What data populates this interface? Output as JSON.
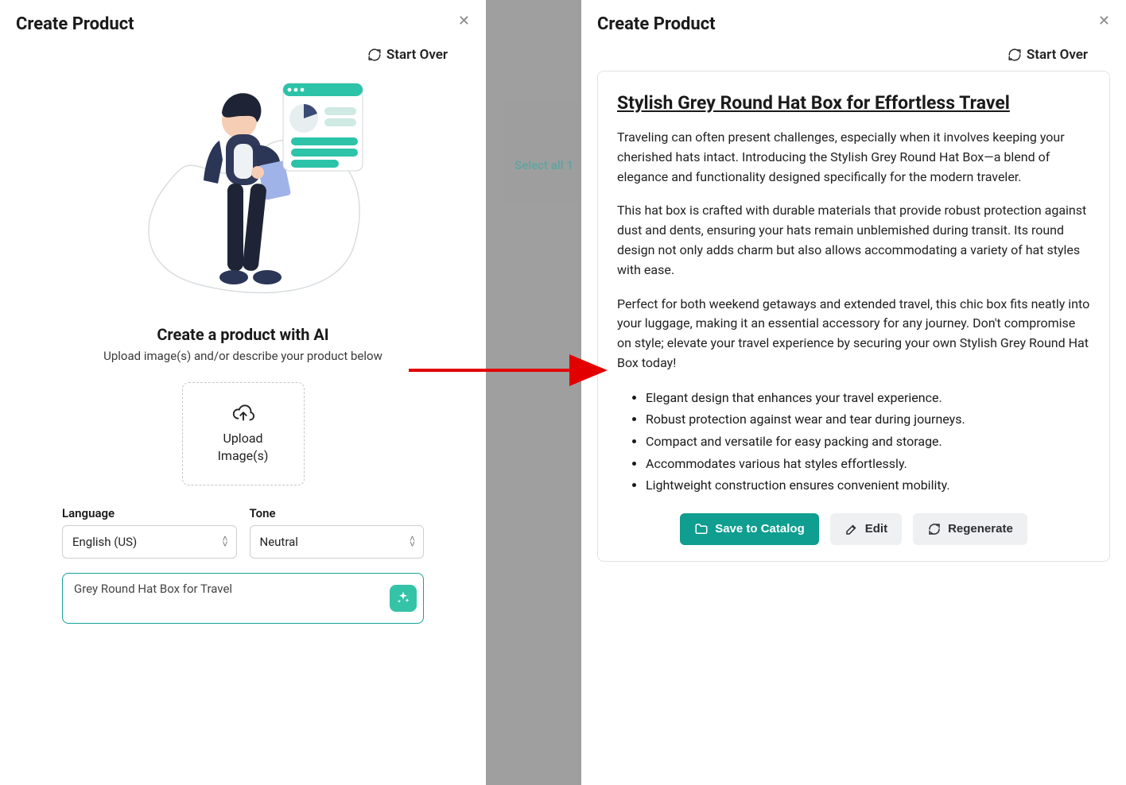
{
  "left": {
    "title": "Create Product",
    "startOver": "Start Over",
    "createHeading": "Create a product with AI",
    "createSub": "Upload image(s) and/or describe your product below",
    "uploadLabel1": "Upload",
    "uploadLabel2": "Image(s)",
    "languageLabel": "Language",
    "languageValue": "English (US)",
    "toneLabel": "Tone",
    "toneValue": "Neutral",
    "promptValue": "Grey Round Hat Box for Travel"
  },
  "mid": {
    "selectAll": "Select all 1"
  },
  "right": {
    "title": "Create Product",
    "startOver": "Start Over",
    "resultTitle": "Stylish Grey Round Hat Box for Effortless Travel",
    "p1": "Traveling can often present challenges, especially when it involves keeping your cherished hats intact. Introducing the Stylish Grey Round Hat Box—a blend of elegance and functionality designed specifically for the modern traveler.",
    "p2": "This hat box is crafted with durable materials that provide robust protection against dust and dents, ensuring your hats remain unblemished during transit. Its round design not only adds charm but also allows accommodating a variety of hat styles with ease.",
    "p3": "Perfect for both weekend getaways and extended travel, this chic box fits neatly into your luggage, making it an essential accessory for any journey. Don't compromise on style; elevate your travel experience by securing your own Stylish Grey Round Hat Box today!",
    "bullets": [
      "Elegant design that enhances your travel experience.",
      "Robust protection against wear and tear during journeys.",
      "Compact and versatile for easy packing and storage.",
      "Accommodates various hat styles effortlessly.",
      "Lightweight construction ensures convenient mobility."
    ],
    "save": "Save to Catalog",
    "edit": "Edit",
    "regen": "Regenerate"
  }
}
